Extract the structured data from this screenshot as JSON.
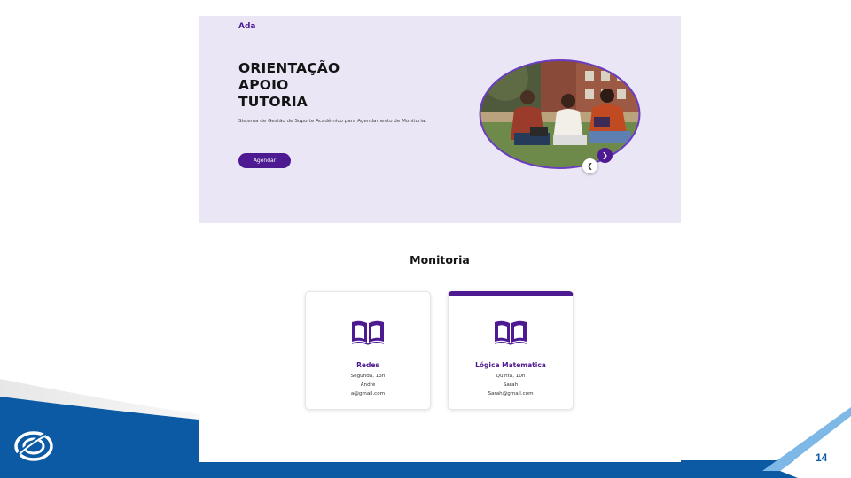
{
  "site": {
    "brand": "Ada",
    "hero": {
      "title_lines": [
        "ORIENTAÇÃO",
        "APOIO",
        "TUTORIA"
      ],
      "description": "Sistema de Gestão de Suporte Acadêmico para Agendamento de Monitoria.",
      "cta_label": "Agendar"
    },
    "carousel": {
      "next_icon": "chevron-right-icon",
      "prev_icon": "chevron-left-icon"
    },
    "section_title": "Monitoria",
    "cards": [
      {
        "name": "Redes",
        "schedule": "Segunda, 13h",
        "tutor": "André",
        "email": "a@gmail.com",
        "icon": "open-book-icon"
      },
      {
        "name": "Lógica Matematica",
        "schedule": "Quinta, 10h",
        "tutor": "Sarah",
        "email": "Sarah@gmail.com",
        "icon": "open-book-icon"
      }
    ]
  },
  "slide": {
    "page_number": "14"
  },
  "colors": {
    "brand_purple": "#4d1a91",
    "hero_background": "#ebe6f6",
    "slide_blue": "#0b5aa3",
    "slide_light_blue": "#7db8e6"
  }
}
